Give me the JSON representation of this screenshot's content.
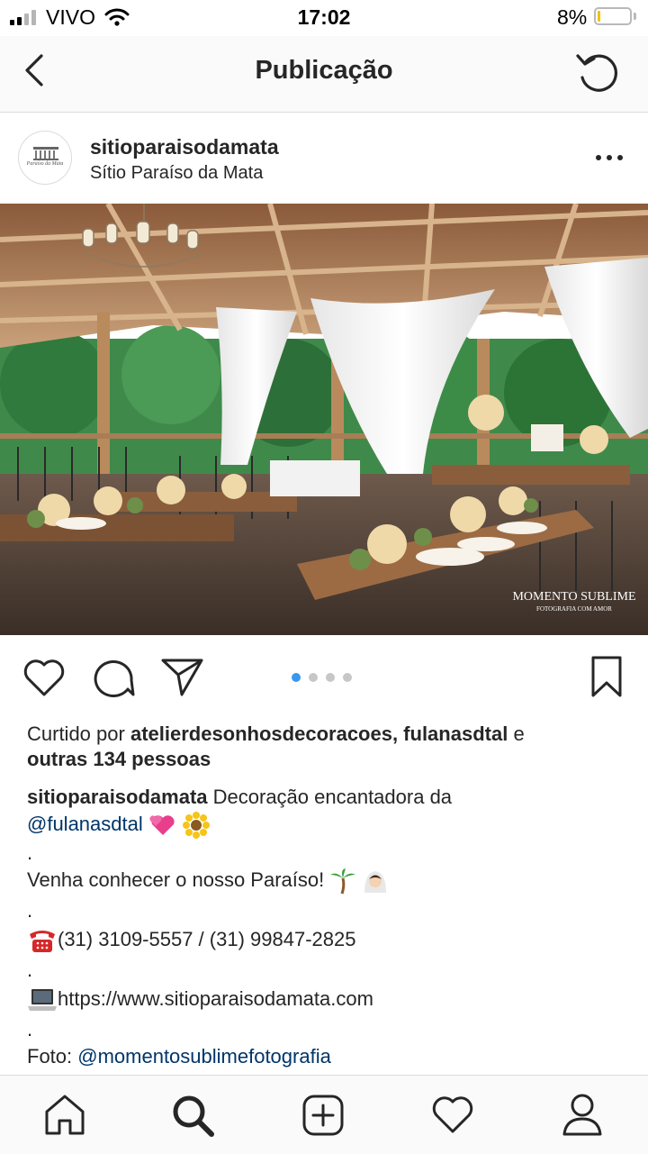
{
  "status_bar": {
    "carrier": "VIVO",
    "time": "17:02",
    "battery_percent": "8%",
    "battery_level": 0.08
  },
  "nav": {
    "title": "Publicação",
    "back_icon": "chevron-left-icon",
    "refresh_icon": "refresh-icon"
  },
  "post": {
    "username": "sitioparaisodamata",
    "location": "Sítio Paraíso da Mata",
    "avatar_text": "Paraíso da Mata",
    "photo_watermark": {
      "line1": "MOMENTO SUBLIME",
      "line2": "FOTOGRAFIA COM AMOR"
    },
    "carousel": {
      "count": 4,
      "active": 0,
      "active_color": "#3897f0"
    }
  },
  "likes": {
    "prefix": "Curtido por ",
    "names": "atelierdesonhosdecoracoes, fulanasdtal",
    "conj": " e",
    "others": "outras 134 pessoas"
  },
  "caption": {
    "username": "sitioparaisodamata",
    "line1": " Decoração encantadora da",
    "mention1": "@fulanasdtal",
    "dot": ".",
    "line2": "Venha conhecer o nosso Paraíso! ",
    "phone": "(31) 3109-5557 / (31) 99847-2825",
    "url": "https://www.sitioparaisodamata.com",
    "credit_prefix": "Foto: ",
    "credit_mention": "@momentosublimefotografia"
  },
  "tabbar": {
    "items": [
      "home-icon",
      "search-icon",
      "add-post-icon",
      "activity-heart-icon",
      "profile-icon"
    ],
    "active": "search-icon"
  }
}
